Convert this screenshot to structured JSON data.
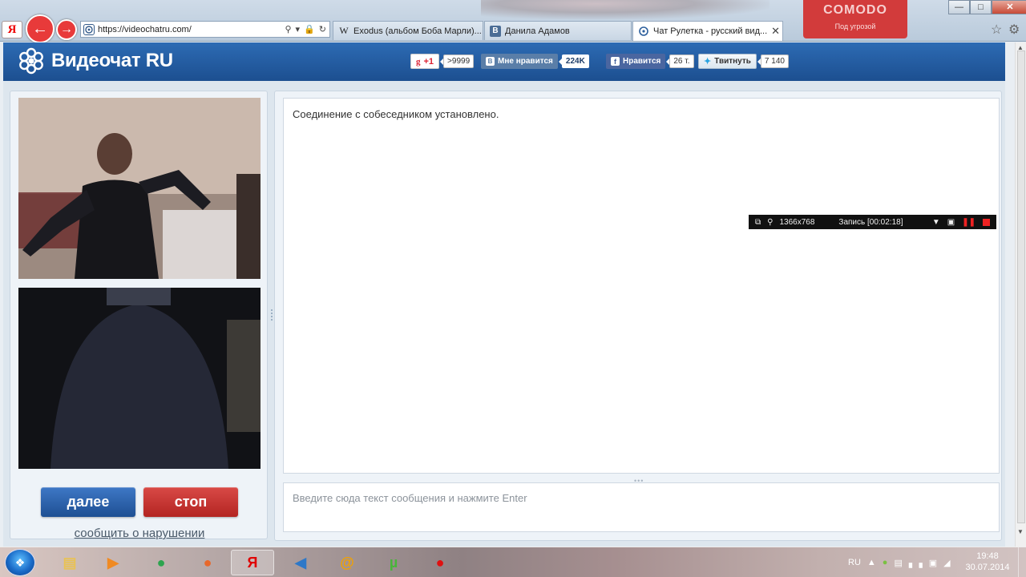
{
  "browser": {
    "address": "https://videochatru.com/",
    "tabs": [
      {
        "label": "Exodus (альбом Боба Марли)...",
        "icon": "wikipedia-icon"
      },
      {
        "label": "Данила Адамов",
        "icon": "vk-icon"
      },
      {
        "label": "Чат Рулетка - русский вид...",
        "icon": "site-icon",
        "active": true
      }
    ],
    "yandex_letter": "Я",
    "comodo_label": "COMODO",
    "comodo_sub": "Под угрозой",
    "window_controls": [
      "—",
      "□",
      "✕"
    ]
  },
  "site": {
    "logo_text": "Видеочат RU",
    "social": {
      "gplus_label": "+1",
      "gplus_count": ">9999",
      "vk_label": "Мне нравится",
      "vk_count": "224K",
      "fb_label": "Нравится",
      "fb_count": "26 т.",
      "tw_label": "Твитнуть",
      "tw_count": "7 140"
    }
  },
  "controls": {
    "next_label": "далее",
    "stop_label": "стоп",
    "report_label": "сообщить о нарушении"
  },
  "chat": {
    "status_message": "Соединение с собеседником установлено.",
    "input_placeholder": "Введите сюда текст сообщения и нажмите Enter"
  },
  "recorder": {
    "resolution": "1366x768",
    "status": "Запись [00:02:18]"
  },
  "taskbar": {
    "apps": [
      {
        "name": "explorer-app",
        "glyph": "▤",
        "color": "#e9c253"
      },
      {
        "name": "media-player-app",
        "glyph": "▶",
        "color": "#f08a22"
      },
      {
        "name": "chrome-app",
        "glyph": "●",
        "color": "#2da44e"
      },
      {
        "name": "firefox-app",
        "glyph": "●",
        "color": "#e7682b"
      },
      {
        "name": "yandex-browser-app",
        "glyph": "Я",
        "color": "#e00000"
      },
      {
        "name": "volume-app",
        "glyph": "◀",
        "color": "#2d78c8"
      },
      {
        "name": "mail-agent-app",
        "glyph": "@",
        "color": "#f2a200"
      },
      {
        "name": "utorrent-app",
        "glyph": "µ",
        "color": "#48b53a"
      },
      {
        "name": "recorder-app",
        "glyph": "●",
        "color": "#e01010"
      }
    ],
    "language": "RU",
    "time": "19:48",
    "date": "30.07.2014"
  }
}
